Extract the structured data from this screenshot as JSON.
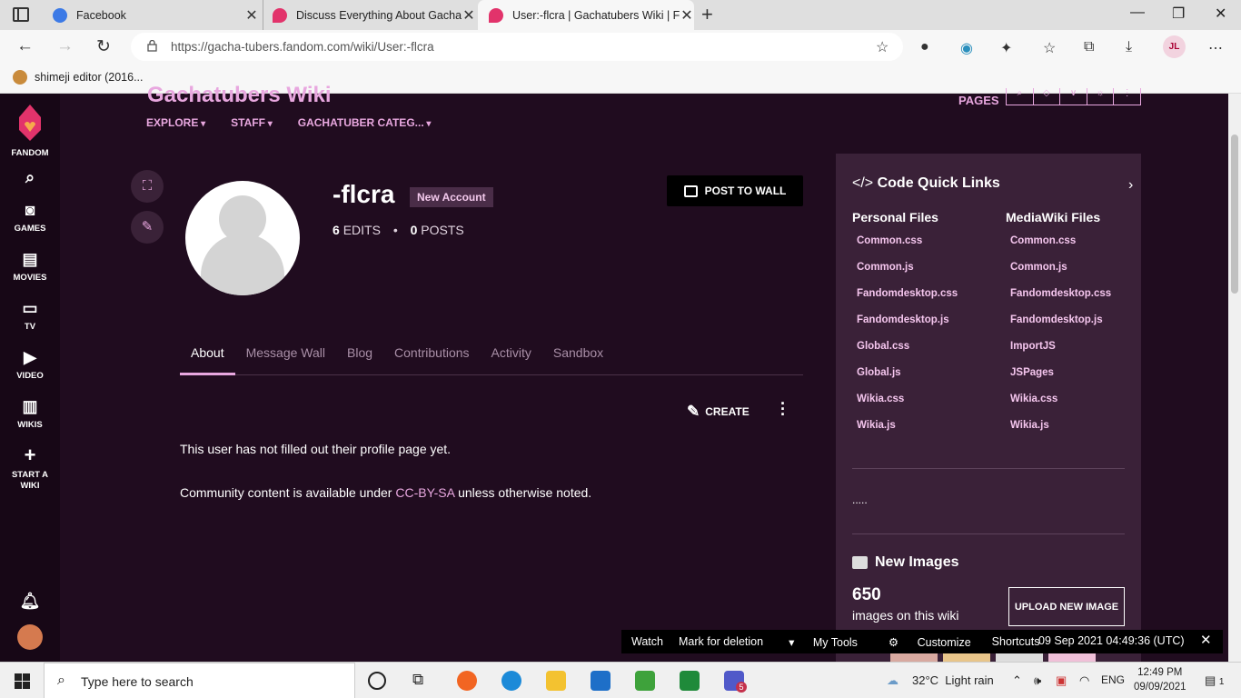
{
  "browser": {
    "tabs": [
      {
        "title": "Facebook"
      },
      {
        "title": "Discuss Everything About Gacha"
      },
      {
        "title": "User:-flcra | Gachatubers Wiki | Fa"
      }
    ],
    "url": "https://gacha-tubers.fandom.com/wiki/User:-flcra",
    "favorites": [
      {
        "label": "shimeji editor (2016..."
      }
    ],
    "profile_initials": "JL"
  },
  "rail": {
    "brand": "FANDOM",
    "items": [
      {
        "label": "GAMES"
      },
      {
        "label": "MOVIES"
      },
      {
        "label": "TV"
      },
      {
        "label": "VIDEO"
      },
      {
        "label": "WIKIS"
      },
      {
        "label": "START A WIKI"
      }
    ]
  },
  "header": {
    "wiki_title": "Gachatubers Wiki",
    "nav": [
      "EXPLORE",
      "STAFF",
      "GACHATUBER CATEG..."
    ],
    "pages_label": "PAGES"
  },
  "profile": {
    "username": "-flcra",
    "badge": "New Account",
    "edits_count": "6",
    "edits_label": "EDITS",
    "posts_count": "0",
    "posts_label": "POSTS",
    "post_to_wall": "POST TO WALL"
  },
  "tabs": [
    "About",
    "Message Wall",
    "Blog",
    "Contributions",
    "Activity",
    "Sandbox"
  ],
  "content": {
    "create_label": "CREATE",
    "empty_message": "This user has not filled out their profile page yet.",
    "license_prefix": "Community content is available under ",
    "license_link": "CC-BY-SA",
    "license_suffix": " unless otherwise noted."
  },
  "right_rail": {
    "title": "Code Quick Links",
    "personal_files": {
      "heading": "Personal Files",
      "links": [
        "Common.css",
        "Common.js",
        "Fandomdesktop.css",
        "Fandomdesktop.js",
        "Global.css",
        "Global.js",
        "Wikia.css",
        "Wikia.js"
      ]
    },
    "mediawiki_files": {
      "heading": "MediaWiki Files",
      "links": [
        "Common.css",
        "Common.js",
        "Fandomdesktop.css",
        "Fandomdesktop.js",
        "ImportJS",
        "JSPages",
        "Wikia.css",
        "Wikia.js"
      ]
    },
    "dots": ".....",
    "new_images": {
      "title": "New Images",
      "count": "650",
      "subtitle": "images on this wiki",
      "upload_label": "UPLOAD NEW IMAGE"
    }
  },
  "bottom_toolbar": {
    "watch": "Watch",
    "mark_deletion": "Mark for deletion",
    "my_tools": "My Tools",
    "customize": "Customize",
    "shortcuts": "Shortcuts",
    "timestamp": "09 Sep 2021 04:49:36 (UTC)"
  },
  "taskbar": {
    "search_placeholder": "Type here to search",
    "temperature": "32°C",
    "weather": "Light rain",
    "language": "ENG",
    "time": "12:49 PM",
    "date": "09/09/2021",
    "notification_count": "1",
    "teams_badge": "5"
  }
}
